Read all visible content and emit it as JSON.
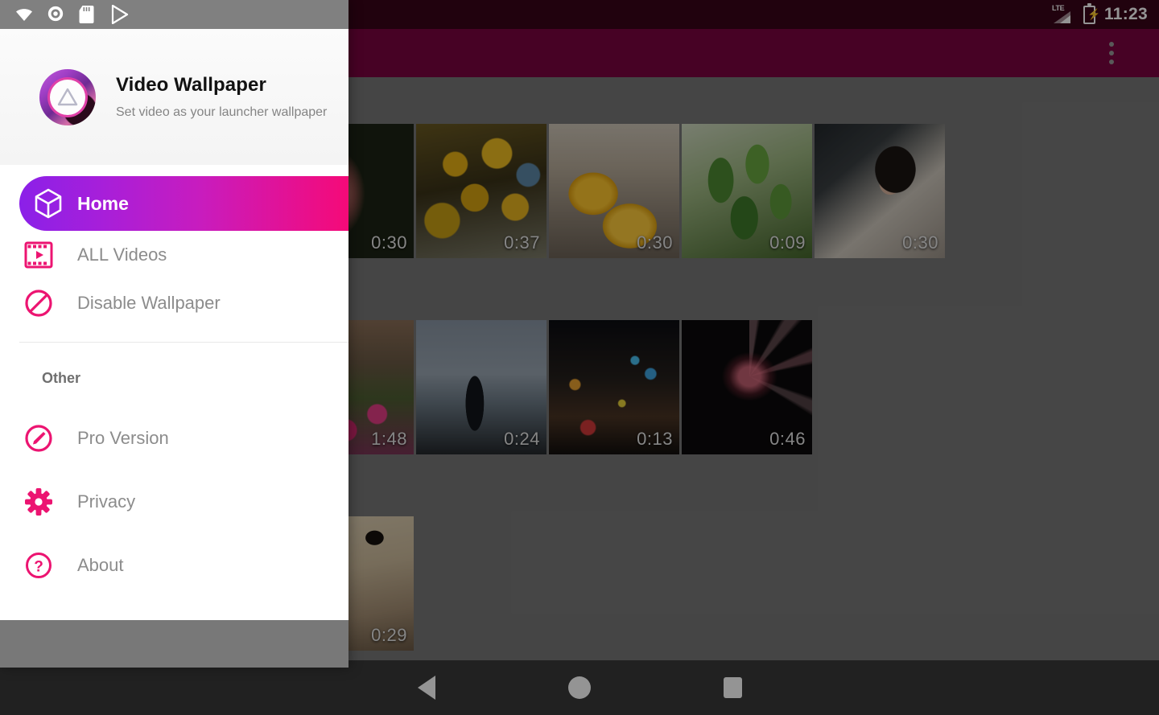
{
  "statusbar": {
    "time": "11:23",
    "network_label": "LTE",
    "left_icons": [
      "wifi-icon",
      "screen-record-icon",
      "sd-card-icon",
      "play-store-icon"
    ],
    "right_icons": [
      "lte-signal-icon",
      "battery-charging-icon"
    ]
  },
  "appbar": {
    "title": "",
    "overflow_label": "More options",
    "background": "#C2185B",
    "dimmed_background": "#7a0540"
  },
  "drawer": {
    "app_title": "Video Wallpaper",
    "app_subtitle": "Set video as your launcher wallpaper",
    "avatar_name": "app-logo",
    "primary_items": [
      {
        "label": "Home",
        "icon": "cube-icon",
        "active": true
      },
      {
        "label": "ALL Videos",
        "icon": "film-play-icon",
        "active": false
      },
      {
        "label": "Disable Wallpaper",
        "icon": "block-icon",
        "active": false
      }
    ],
    "section_title": "Other",
    "other_items": [
      {
        "label": "Pro Version",
        "icon": "pen-circle-icon"
      },
      {
        "label": "Privacy",
        "icon": "gear-icon"
      },
      {
        "label": "About",
        "icon": "question-circle-icon"
      }
    ],
    "accent_start": "#8B20E8",
    "accent_end": "#F50A78",
    "icon_color": "#EC1471"
  },
  "content": {
    "rows": [
      {
        "videos": [
          {
            "art": "art-rose",
            "duration": "0:30",
            "name": "rose-video"
          },
          {
            "art": "art-ginkgo",
            "duration": "0:37",
            "name": "ginkgo-leaves-video"
          },
          {
            "art": "art-mango",
            "duration": "0:30",
            "name": "mango-video"
          },
          {
            "art": "art-mint",
            "duration": "0:09",
            "name": "mint-plant-video"
          },
          {
            "art": "art-girl",
            "duration": "0:30",
            "name": "portrait-video"
          }
        ]
      },
      {
        "videos": [
          {
            "art": "art-tulip",
            "duration": "1:48",
            "name": "tulip-field-video"
          },
          {
            "art": "art-stand",
            "duration": "0:24",
            "name": "mountain-person-video"
          },
          {
            "art": "art-city",
            "duration": "0:13",
            "name": "night-city-video"
          },
          {
            "art": "art-fire",
            "duration": "0:46",
            "name": "fireworks-video"
          }
        ]
      },
      {
        "videos": [
          {
            "art": "art-dog",
            "duration": "0:29",
            "name": "dog-video"
          }
        ]
      }
    ]
  },
  "navbar": {
    "back_label": "Back",
    "home_label": "Home",
    "recents_label": "Recents",
    "background": "#3a3a3a"
  }
}
